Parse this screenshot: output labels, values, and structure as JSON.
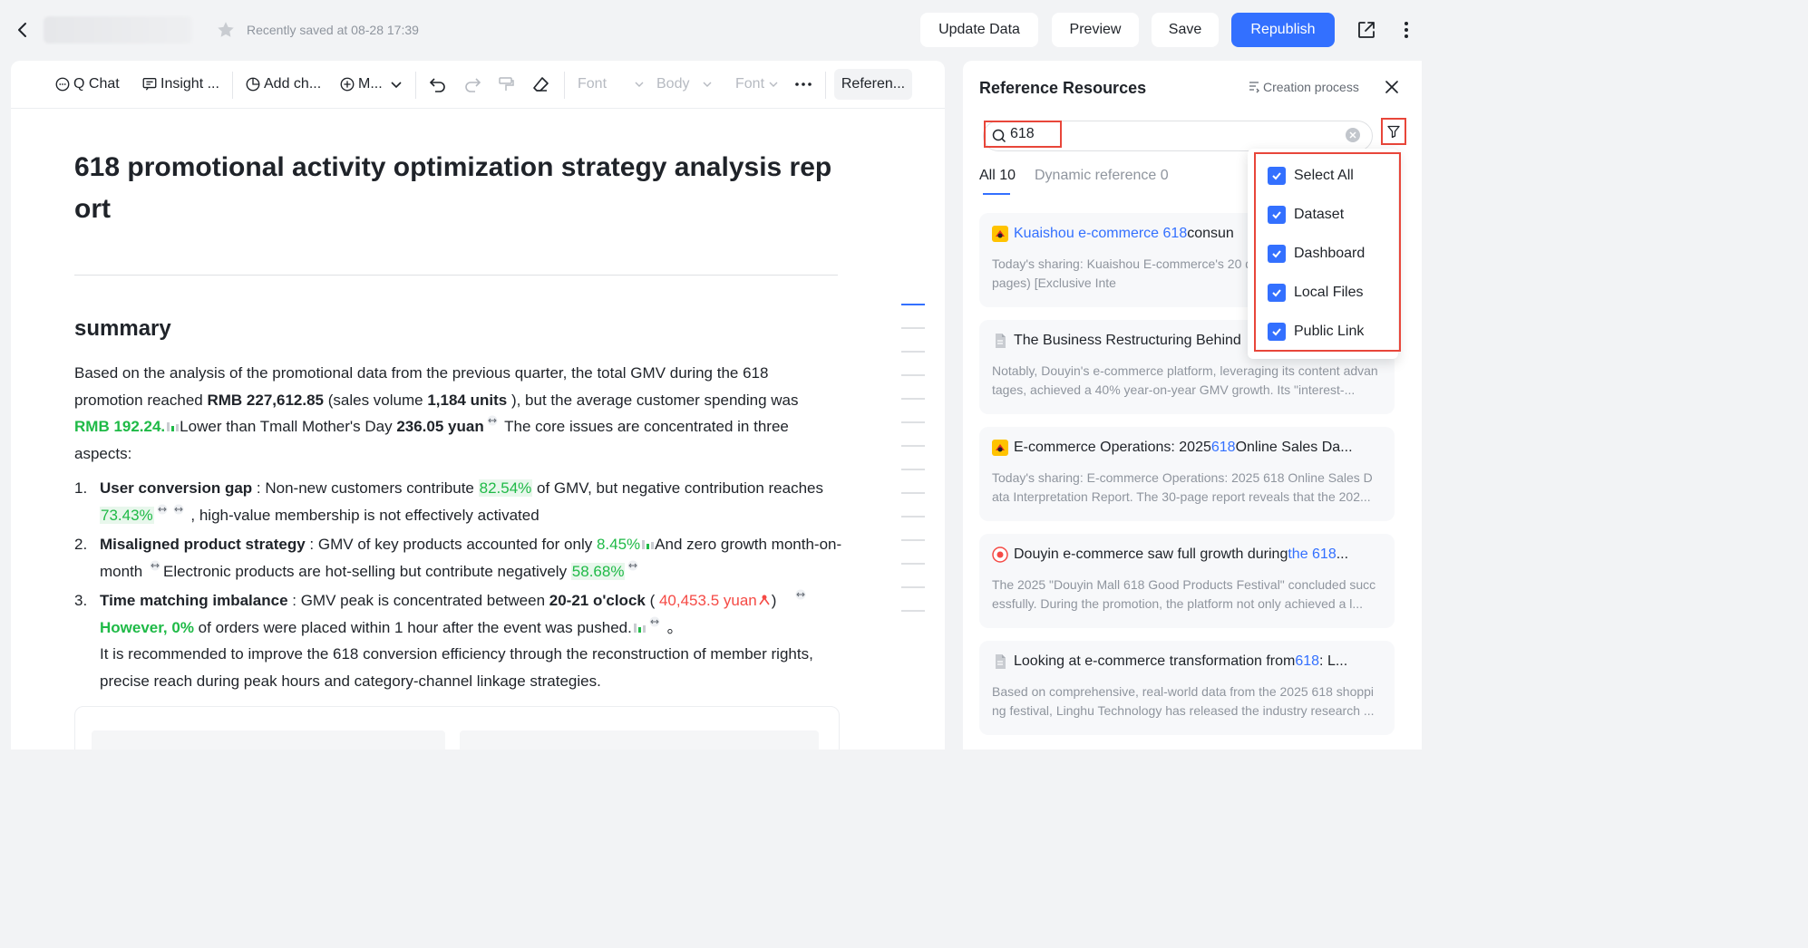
{
  "header": {
    "saved_status": "Recently saved at 08-28 17:39",
    "buttons": {
      "update": "Update Data",
      "preview": "Preview",
      "save": "Save",
      "republish": "Republish"
    },
    "colors": {
      "primary": "#3370ff"
    }
  },
  "toolbar": {
    "chat": "Q Chat",
    "insight": "Insight ...",
    "add_chart": "Add ch...",
    "more": "M...",
    "font1": "Font",
    "body": "Body",
    "font2": "Font",
    "reference": "Referen..."
  },
  "doc": {
    "title": "618 promotional activity optimization strategy analysis report",
    "summary_heading": "summary",
    "para": {
      "p1": "Based on the analysis of the promotional data from the previous quarter, the total GMV during the 618 promotion reached ",
      "gmv": "RMB 227,612.85",
      "p2": " (sales volume ",
      "units": "1,184 units",
      "p3": " ), but the average customer spending was ",
      "rmb": "RMB 192.24.",
      "p4": "Lower than Tmall Mother's Day ",
      "yuan": "236.05 yuan",
      "p5": " The core issues are concentrated in three aspects:"
    },
    "items": [
      {
        "num": "1.",
        "bold": "User conversion gap",
        "t1": " : Non-new customers contribute ",
        "v1": "82.54%",
        "t2": "  of GMV, but negative contribution reaches ",
        "v2": "73.43%",
        "t3": " , high-value membership is not effectively activated"
      },
      {
        "num": "2.",
        "bold": "Misaligned product strategy",
        "t1": " : GMV of key products accounted for only ",
        "v1": "8.45%",
        "t2": "And zero growth month-on-month ",
        "t3": "Electronic products are hot-selling but contribute negatively ",
        "v2": "58.68%"
      },
      {
        "num": "3.",
        "bold": "Time matching imbalance",
        "t1": " : GMV peak is concentrated between ",
        "time": "20-21 o'clock",
        "t2": " ( ",
        "peak": "40,453.5 yuan",
        "t3": ")",
        "however": "However, 0%",
        "t4": " of orders were placed within 1 hour after the event was pushed.",
        "t5": " 。",
        "rec": "It is recommended to improve the 618 conversion efficiency through the reconstruction of member rights, precise reach during peak hours and category-channel linkage strategies."
      }
    ]
  },
  "ref_panel": {
    "title": "Reference Resources",
    "creation_process": "Creation process",
    "search_value": "618",
    "tabs": {
      "all": "All 10",
      "dynamic": "Dynamic reference 0"
    },
    "cards": [
      {
        "icon": "kuaishou-logo-icon",
        "title_a": "Kuaishou e-commerce 618",
        "title_b": " consun",
        "body": "Today's sharing: Kuaishou E-commerce's 20 ds Preview Report (57 pages) [Exclusive Inte"
      },
      {
        "icon": "document-icon",
        "title_a": "",
        "title_b": "The Business Restructuring Behind",
        "body": "Notably, Douyin's e-commerce platform, leveraging its content advantages, achieved a 40% year-on-year GMV growth. Its \"interest-..."
      },
      {
        "icon": "kuaishou-logo-icon",
        "title_a": "E-commerce Operations: 2025 ",
        "title_hl": "618",
        "title_b": " Online Sales Da...",
        "body": "Today's sharing: E-commerce Operations: 2025 618 Online Sales Data Interpretation Report. The 30-page report reveals that the 202..."
      },
      {
        "icon": "douyin-logo-icon",
        "title_a": "Douyin e-commerce saw full growth during ",
        "title_hl": "the 618",
        "title_b": " ...",
        "body": "The 2025 \"Douyin Mall 618 Good Products Festival\" concluded successfully. During the promotion, the platform not only achieved a l..."
      },
      {
        "icon": "document-icon",
        "title_a": "Looking at e-commerce transformation from ",
        "title_hl": "618",
        "title_b": " : L...",
        "body": "Based on comprehensive, real-world data from the 2025 618 shopping festival, Linghu Technology has released the industry research ..."
      }
    ],
    "filter_options": [
      {
        "label": "Select All",
        "checked": true
      },
      {
        "label": "Dataset",
        "checked": true
      },
      {
        "label": "Dashboard",
        "checked": true
      },
      {
        "label": "Local Files",
        "checked": true
      },
      {
        "label": "Public Link",
        "checked": true
      }
    ]
  }
}
